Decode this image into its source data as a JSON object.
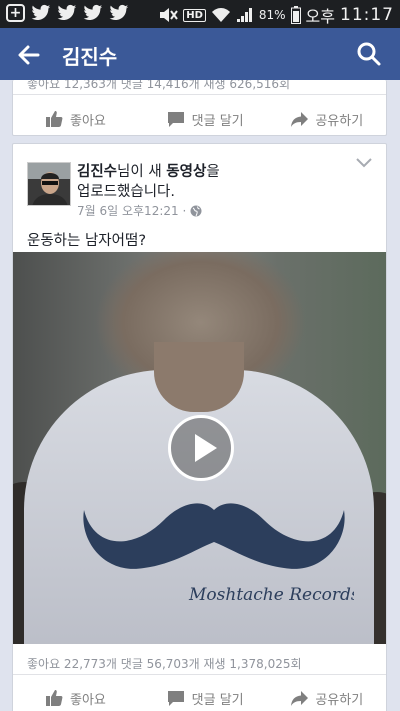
{
  "status_bar": {
    "battery": "81%",
    "ampm": "오후",
    "time": "11:17",
    "network": "HD"
  },
  "header": {
    "title": "김진수"
  },
  "previous_post": {
    "stats": "좋아요 12,363개 댓글 14,416개 재생 626,516회",
    "actions": {
      "like": "좋아요",
      "comment": "댓글 달기",
      "share": "공유하기"
    }
  },
  "post": {
    "author": "김진수",
    "action_a": "님이 새 ",
    "action_b": "동영상",
    "action_c": "을",
    "action_d": "업로드했습니다.",
    "time": "7월 6일 오후12:21 ·",
    "text": "운동하는 남자어떰?",
    "video_text": "Moshtache Records",
    "stats": "좋아요 22,773개 댓글 56,703개 재생 1,378,025회",
    "actions": {
      "like": "좋아요",
      "comment": "댓글 달기",
      "share": "공유하기"
    }
  },
  "colors": {
    "brand": "#3b5998",
    "status_bar": "#1d1f22",
    "feed_bg": "#dfe3ee"
  }
}
